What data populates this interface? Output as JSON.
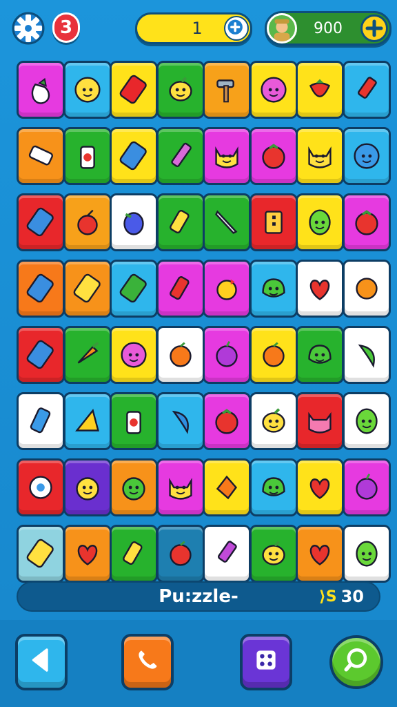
{
  "hud": {
    "lives": "3",
    "level": "1",
    "coins": "900"
  },
  "board": {
    "rows": [
      [
        {
          "bg": "#e63ae0",
          "icon": "eggplant"
        },
        {
          "bg": "#2fb6ec",
          "icon": "smiley"
        },
        {
          "bg": "#ffe21a",
          "icon": "phone-red"
        },
        {
          "bg": "#27b22d",
          "icon": "lemon"
        },
        {
          "bg": "#f7a11a",
          "icon": "hammer"
        },
        {
          "bg": "#ffe21a",
          "icon": "flower-face"
        },
        {
          "bg": "#ffe21a",
          "icon": "strawberry"
        },
        {
          "bg": "#2fb6ec",
          "icon": "crayon-red"
        }
      ],
      [
        {
          "bg": "#f7921a",
          "icon": "eraser"
        },
        {
          "bg": "#27b22d",
          "icon": "glue"
        },
        {
          "bg": "#ffe21a",
          "icon": "phone-blue"
        },
        {
          "bg": "#27b22d",
          "icon": "pencil"
        },
        {
          "bg": "#e63ae0",
          "icon": "cat-face"
        },
        {
          "bg": "#e63ae0",
          "icon": "tomato"
        },
        {
          "bg": "#ffe21a",
          "icon": "cat-face"
        },
        {
          "bg": "#2fb6ec",
          "icon": "blob-blue"
        }
      ],
      [
        {
          "bg": "#e8272b",
          "icon": "phone-blue"
        },
        {
          "bg": "#f7a11a",
          "icon": "cherry"
        },
        {
          "bg": "#ffffff",
          "icon": "bird-blue"
        },
        {
          "bg": "#27b22d",
          "icon": "lighter"
        },
        {
          "bg": "#27b22d",
          "icon": "knife"
        },
        {
          "bg": "#e8272b",
          "icon": "sign"
        },
        {
          "bg": "#ffe21a",
          "icon": "egg-green"
        },
        {
          "bg": "#e63ae0",
          "icon": "tomato"
        }
      ],
      [
        {
          "bg": "#f7791a",
          "icon": "phone-blue"
        },
        {
          "bg": "#f7921a",
          "icon": "phone-yellow"
        },
        {
          "bg": "#2fb6ec",
          "icon": "phone-green"
        },
        {
          "bg": "#e63ae0",
          "icon": "lighter-red"
        },
        {
          "bg": "#e63ae0",
          "icon": "lemon-bird"
        },
        {
          "bg": "#2fb6ec",
          "icon": "lettuce"
        },
        {
          "bg": "#ffffff",
          "icon": "heart-red"
        },
        {
          "bg": "#ffffff",
          "icon": "orange-star"
        }
      ],
      [
        {
          "bg": "#e8272b",
          "icon": "phone-blue"
        },
        {
          "bg": "#27b22d",
          "icon": "carrot"
        },
        {
          "bg": "#ffe21a",
          "icon": "flower-face"
        },
        {
          "bg": "#ffffff",
          "icon": "peach"
        },
        {
          "bg": "#e63ae0",
          "icon": "plum"
        },
        {
          "bg": "#ffe21a",
          "icon": "peach"
        },
        {
          "bg": "#27b22d",
          "icon": "lettuce"
        },
        {
          "bg": "#ffffff",
          "icon": "pepper-green"
        }
      ],
      [
        {
          "bg": "#ffffff",
          "icon": "eraser-blue"
        },
        {
          "bg": "#2fb6ec",
          "icon": "cheese"
        },
        {
          "bg": "#27b22d",
          "icon": "glue"
        },
        {
          "bg": "#2fb6ec",
          "icon": "pepper-blue"
        },
        {
          "bg": "#e63ae0",
          "icon": "tomato"
        },
        {
          "bg": "#ffffff",
          "icon": "lemon"
        },
        {
          "bg": "#e8272b",
          "icon": "cat-pink"
        },
        {
          "bg": "#ffffff",
          "icon": "egg-green"
        }
      ],
      [
        {
          "bg": "#e8272b",
          "icon": "splat"
        },
        {
          "bg": "#6a2fcf",
          "icon": "frog-face"
        },
        {
          "bg": "#f7921a",
          "icon": "frog-green"
        },
        {
          "bg": "#e63ae0",
          "icon": "cat-face"
        },
        {
          "bg": "#ffe21a",
          "icon": "leaf-orange"
        },
        {
          "bg": "#2fb6ec",
          "icon": "lettuce"
        },
        {
          "bg": "#ffe21a",
          "icon": "heart-red"
        },
        {
          "bg": "#e63ae0",
          "icon": "plum"
        }
      ],
      [
        {
          "bg": "#8fd3e0",
          "icon": "phone-yellow"
        },
        {
          "bg": "#f7921a",
          "icon": "heart-red"
        },
        {
          "bg": "#27b22d",
          "icon": "lighter"
        },
        {
          "bg": "#1e7fb0",
          "icon": "apple"
        },
        {
          "bg": "#ffffff",
          "icon": "crayon-purple"
        },
        {
          "bg": "#27b22d",
          "icon": "lemon"
        },
        {
          "bg": "#f7921a",
          "icon": "heart-red"
        },
        {
          "bg": "#ffffff",
          "icon": "egg-green"
        }
      ]
    ]
  },
  "status": {
    "title": "Pu:zzle-",
    "timer_icon": "⟩S",
    "timer": "30"
  },
  "bottom_buttons": [
    {
      "name": "back",
      "icon": "triangle-left-icon",
      "color": "#2fb6ec"
    },
    {
      "name": "call",
      "icon": "phone-icon",
      "color": "#f7791a"
    },
    {
      "name": "robot",
      "icon": "dice-icon",
      "color": "#6a35d6"
    },
    {
      "name": "hint",
      "icon": "magnifier-icon",
      "color": "#5cc92e"
    }
  ]
}
